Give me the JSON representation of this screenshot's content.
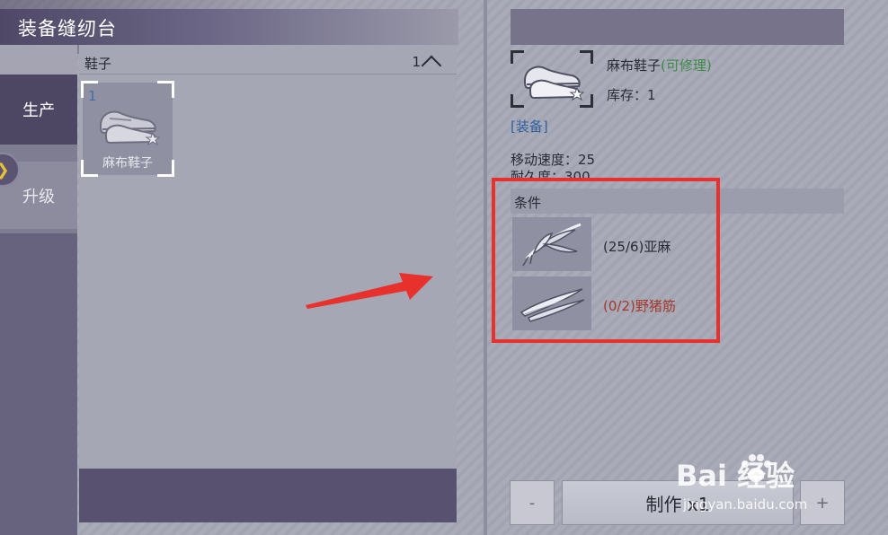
{
  "window": {
    "title": "装备缝纫台"
  },
  "tabs": [
    {
      "label": "生产",
      "active": true
    },
    {
      "label": "升级",
      "active": false
    }
  ],
  "list": {
    "category": "鞋子",
    "count": "1",
    "items": [
      {
        "count": "1",
        "name": "麻布鞋子"
      }
    ]
  },
  "detail": {
    "name": "麻布鞋子",
    "repair_note": "(可修理)",
    "stock": "库存：1",
    "category": "[装备]",
    "stats": [
      "移动速度：25",
      "耐久度：300"
    ],
    "conditions_title": "条件",
    "materials": [
      {
        "label": "(25/6)亚麻",
        "color": "#2a2a34",
        "icon": "flax-icon"
      },
      {
        "label": "(0/2)野猪筋",
        "color": "#a2392b",
        "icon": "boar-tendon-icon"
      }
    ]
  },
  "actions": {
    "minus": "-",
    "make": "制作 x1",
    "plus": "+"
  },
  "watermark": {
    "brand": "Bai  经验",
    "url": "jingyan.baidu.com"
  },
  "colors": {
    "highlight": "#e8302c",
    "repair_green": "#3e8a46",
    "missing_red": "#a2392b",
    "category_blue": "#2f5fa0"
  }
}
